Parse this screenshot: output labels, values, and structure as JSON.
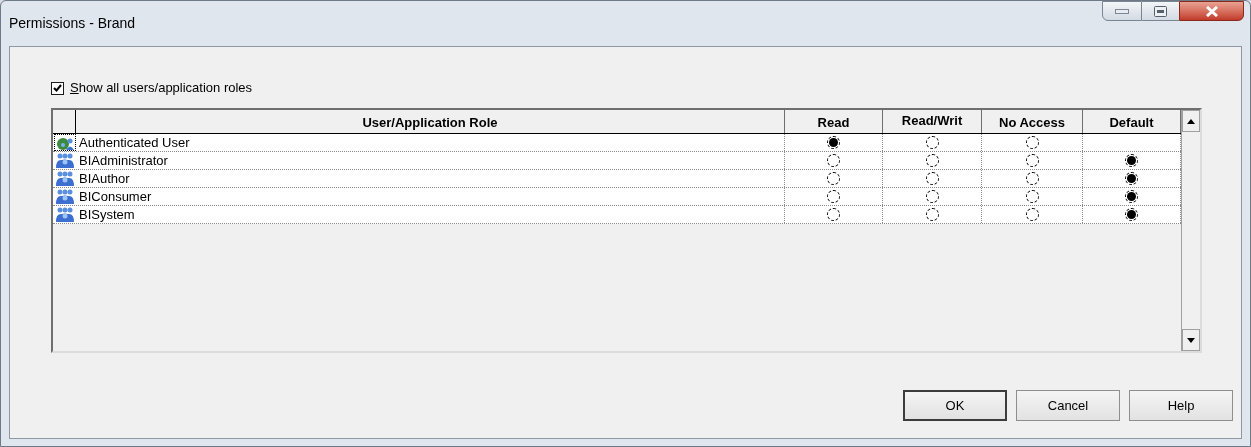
{
  "window": {
    "title": "Permissions - Brand"
  },
  "show_all": {
    "label": "Show all users/application roles",
    "checked": true
  },
  "table": {
    "columns": [
      "User/Application Role",
      "Read",
      "Read/Writ",
      "No Access",
      "Default"
    ],
    "rows": [
      {
        "name": "Authenticated User",
        "kind": "user",
        "options": [
          {
            "selected": true
          },
          {
            "selected": false
          },
          {
            "selected": false
          }
        ]
      },
      {
        "name": "BIAdministrator",
        "kind": "group",
        "options": [
          {
            "selected": false
          },
          {
            "selected": false
          },
          {
            "selected": false
          },
          {
            "selected": true
          }
        ]
      },
      {
        "name": "BIAuthor",
        "kind": "group",
        "options": [
          {
            "selected": false
          },
          {
            "selected": false
          },
          {
            "selected": false
          },
          {
            "selected": true
          }
        ]
      },
      {
        "name": "BIConsumer",
        "kind": "group",
        "options": [
          {
            "selected": false
          },
          {
            "selected": false
          },
          {
            "selected": false
          },
          {
            "selected": true
          }
        ]
      },
      {
        "name": "BISystem",
        "kind": "group",
        "options": [
          {
            "selected": false
          },
          {
            "selected": false
          },
          {
            "selected": false
          },
          {
            "selected": true
          }
        ]
      }
    ]
  },
  "buttons": [
    "OK",
    "Cancel",
    "Help"
  ]
}
